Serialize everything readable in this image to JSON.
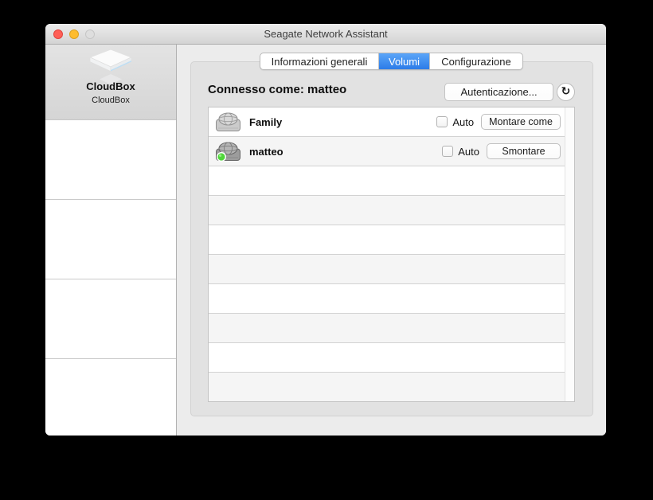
{
  "window": {
    "title": "Seagate Network Assistant"
  },
  "sidebar": {
    "device": {
      "title": "CloudBox",
      "subtitle": "CloudBox",
      "icon": "cloudbox-device-icon"
    }
  },
  "tabs": {
    "items": [
      {
        "label": "Informazioni generali",
        "selected": false
      },
      {
        "label": "Volumi",
        "selected": true
      },
      {
        "label": "Configurazione",
        "selected": false
      }
    ]
  },
  "volumes": {
    "connected_as": "Connesso come: matteo",
    "auth_button": "Autenticazione...",
    "refresh_glyph": "↻",
    "rows": [
      {
        "name": "Family",
        "icon": "network-drive-icon",
        "mounted": false,
        "auto_label": "Auto",
        "auto_checked": false,
        "action": "Montare come"
      },
      {
        "name": "matteo",
        "icon": "network-drive-mounted-icon",
        "mounted": true,
        "auto_label": "Auto",
        "auto_checked": false,
        "action": "Smontare"
      }
    ],
    "empty_rows": 8
  },
  "colors": {
    "tab_selected_blue": "#3c8bf0",
    "traffic_red": "#ff5f57",
    "traffic_yellow": "#febc2e",
    "traffic_disabled_gray": "#dedede",
    "mounted_status_green": "#4fd63a",
    "panel_bg": "#e2e2e2",
    "main_bg": "#ececec"
  }
}
